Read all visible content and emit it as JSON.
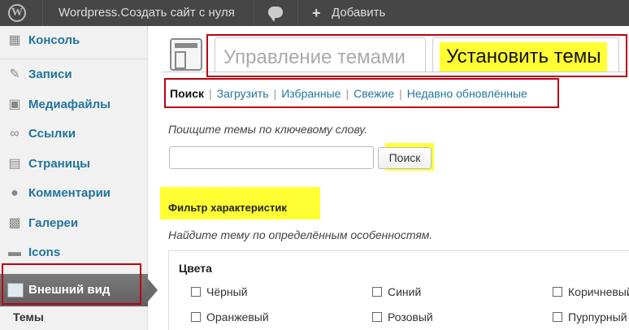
{
  "admin_bar": {
    "logo_glyph": "W",
    "site_name": "Wordpress.Создать сайт с нуля",
    "add_label": "Добавить"
  },
  "sidebar": {
    "items": [
      {
        "label": "Консоль",
        "icon": "dashboard-icon"
      },
      {
        "label": "Записи",
        "icon": "pin-icon"
      },
      {
        "label": "Медиафайлы",
        "icon": "media-icon"
      },
      {
        "label": "Ссылки",
        "icon": "link-icon"
      },
      {
        "label": "Страницы",
        "icon": "page-icon"
      },
      {
        "label": "Комментарии",
        "icon": "comment-icon"
      },
      {
        "label": "Галереи",
        "icon": "gallery-icon"
      },
      {
        "label": "Icons",
        "icon": "icons-icon"
      }
    ],
    "active": {
      "label": "Внешний вид",
      "icon": "appearance-icon"
    },
    "submenu_current": "Темы"
  },
  "tabs": {
    "manage": "Управление темами",
    "install": "Установить темы"
  },
  "filter_nav": {
    "current": "Поиск",
    "links": [
      "Загрузить",
      "Избранные",
      "Свежие",
      "Недавно обновлённые"
    ]
  },
  "search": {
    "hint": "Поищите темы по ключевому слову.",
    "value": "",
    "button": "Поиск"
  },
  "features": {
    "title": "Фильтр характеристик",
    "hint": "Найдите тему по определённым особенностям.",
    "group_title": "Цвета",
    "colors": [
      "Чёрный",
      "Синий",
      "Коричневый",
      "Оранжевый",
      "Розовый",
      "Пурпурный"
    ]
  },
  "colors": {
    "adminbar_bg": "#464646",
    "link": "#21759b",
    "highlight": "#ffff33",
    "annotation": "#bb0011"
  }
}
